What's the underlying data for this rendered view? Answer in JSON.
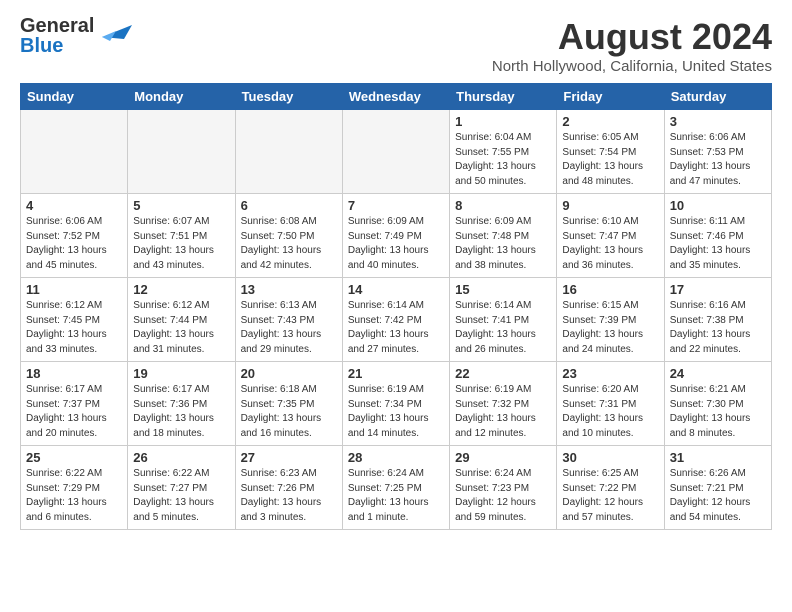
{
  "header": {
    "logo_line1": "General",
    "logo_line2": "Blue",
    "main_title": "August 2024",
    "subtitle": "North Hollywood, California, United States"
  },
  "weekdays": [
    "Sunday",
    "Monday",
    "Tuesday",
    "Wednesday",
    "Thursday",
    "Friday",
    "Saturday"
  ],
  "weeks": [
    [
      {
        "day": "",
        "info": ""
      },
      {
        "day": "",
        "info": ""
      },
      {
        "day": "",
        "info": ""
      },
      {
        "day": "",
        "info": ""
      },
      {
        "day": "1",
        "info": "Sunrise: 6:04 AM\nSunset: 7:55 PM\nDaylight: 13 hours\nand 50 minutes."
      },
      {
        "day": "2",
        "info": "Sunrise: 6:05 AM\nSunset: 7:54 PM\nDaylight: 13 hours\nand 48 minutes."
      },
      {
        "day": "3",
        "info": "Sunrise: 6:06 AM\nSunset: 7:53 PM\nDaylight: 13 hours\nand 47 minutes."
      }
    ],
    [
      {
        "day": "4",
        "info": "Sunrise: 6:06 AM\nSunset: 7:52 PM\nDaylight: 13 hours\nand 45 minutes."
      },
      {
        "day": "5",
        "info": "Sunrise: 6:07 AM\nSunset: 7:51 PM\nDaylight: 13 hours\nand 43 minutes."
      },
      {
        "day": "6",
        "info": "Sunrise: 6:08 AM\nSunset: 7:50 PM\nDaylight: 13 hours\nand 42 minutes."
      },
      {
        "day": "7",
        "info": "Sunrise: 6:09 AM\nSunset: 7:49 PM\nDaylight: 13 hours\nand 40 minutes."
      },
      {
        "day": "8",
        "info": "Sunrise: 6:09 AM\nSunset: 7:48 PM\nDaylight: 13 hours\nand 38 minutes."
      },
      {
        "day": "9",
        "info": "Sunrise: 6:10 AM\nSunset: 7:47 PM\nDaylight: 13 hours\nand 36 minutes."
      },
      {
        "day": "10",
        "info": "Sunrise: 6:11 AM\nSunset: 7:46 PM\nDaylight: 13 hours\nand 35 minutes."
      }
    ],
    [
      {
        "day": "11",
        "info": "Sunrise: 6:12 AM\nSunset: 7:45 PM\nDaylight: 13 hours\nand 33 minutes."
      },
      {
        "day": "12",
        "info": "Sunrise: 6:12 AM\nSunset: 7:44 PM\nDaylight: 13 hours\nand 31 minutes."
      },
      {
        "day": "13",
        "info": "Sunrise: 6:13 AM\nSunset: 7:43 PM\nDaylight: 13 hours\nand 29 minutes."
      },
      {
        "day": "14",
        "info": "Sunrise: 6:14 AM\nSunset: 7:42 PM\nDaylight: 13 hours\nand 27 minutes."
      },
      {
        "day": "15",
        "info": "Sunrise: 6:14 AM\nSunset: 7:41 PM\nDaylight: 13 hours\nand 26 minutes."
      },
      {
        "day": "16",
        "info": "Sunrise: 6:15 AM\nSunset: 7:39 PM\nDaylight: 13 hours\nand 24 minutes."
      },
      {
        "day": "17",
        "info": "Sunrise: 6:16 AM\nSunset: 7:38 PM\nDaylight: 13 hours\nand 22 minutes."
      }
    ],
    [
      {
        "day": "18",
        "info": "Sunrise: 6:17 AM\nSunset: 7:37 PM\nDaylight: 13 hours\nand 20 minutes."
      },
      {
        "day": "19",
        "info": "Sunrise: 6:17 AM\nSunset: 7:36 PM\nDaylight: 13 hours\nand 18 minutes."
      },
      {
        "day": "20",
        "info": "Sunrise: 6:18 AM\nSunset: 7:35 PM\nDaylight: 13 hours\nand 16 minutes."
      },
      {
        "day": "21",
        "info": "Sunrise: 6:19 AM\nSunset: 7:34 PM\nDaylight: 13 hours\nand 14 minutes."
      },
      {
        "day": "22",
        "info": "Sunrise: 6:19 AM\nSunset: 7:32 PM\nDaylight: 13 hours\nand 12 minutes."
      },
      {
        "day": "23",
        "info": "Sunrise: 6:20 AM\nSunset: 7:31 PM\nDaylight: 13 hours\nand 10 minutes."
      },
      {
        "day": "24",
        "info": "Sunrise: 6:21 AM\nSunset: 7:30 PM\nDaylight: 13 hours\nand 8 minutes."
      }
    ],
    [
      {
        "day": "25",
        "info": "Sunrise: 6:22 AM\nSunset: 7:29 PM\nDaylight: 13 hours\nand 6 minutes."
      },
      {
        "day": "26",
        "info": "Sunrise: 6:22 AM\nSunset: 7:27 PM\nDaylight: 13 hours\nand 5 minutes."
      },
      {
        "day": "27",
        "info": "Sunrise: 6:23 AM\nSunset: 7:26 PM\nDaylight: 13 hours\nand 3 minutes."
      },
      {
        "day": "28",
        "info": "Sunrise: 6:24 AM\nSunset: 7:25 PM\nDaylight: 13 hours\nand 1 minute."
      },
      {
        "day": "29",
        "info": "Sunrise: 6:24 AM\nSunset: 7:23 PM\nDaylight: 12 hours\nand 59 minutes."
      },
      {
        "day": "30",
        "info": "Sunrise: 6:25 AM\nSunset: 7:22 PM\nDaylight: 12 hours\nand 57 minutes."
      },
      {
        "day": "31",
        "info": "Sunrise: 6:26 AM\nSunset: 7:21 PM\nDaylight: 12 hours\nand 54 minutes."
      }
    ]
  ]
}
